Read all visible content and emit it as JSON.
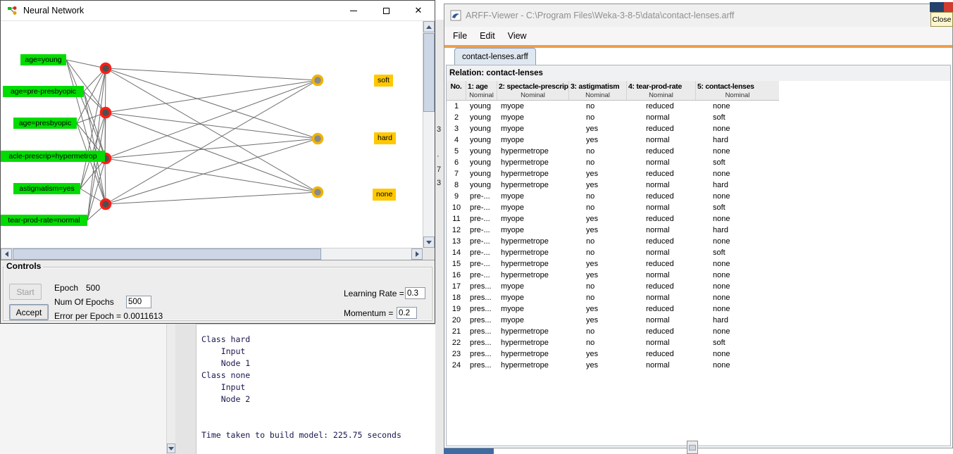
{
  "colors": {
    "input_label_bg": "#00dc00",
    "output_label_bg": "#ffc800",
    "hidden_node_ring": "#ff1e14",
    "hidden_node_center": "#4f4f4f",
    "output_node_ring": "#f0b400",
    "output_node_center": "#8a8a8a",
    "accent_line": "#ee9e49",
    "inactive_title_text": "#8f8f8f"
  },
  "icons": {
    "nn_window_icon": "mini-network",
    "arff_window_icon": "weka-document",
    "minimize": "horizontal-bar",
    "maximize": "square-outline",
    "close_glyph": "✕"
  },
  "nn_window": {
    "title": "Neural Network",
    "caption_buttons": {
      "close": "✕"
    },
    "network": {
      "input_labels": [
        "age=young",
        "age=pre-presbyopic",
        "age=presbyopic",
        "acle-prescrip=hypermetrop",
        "astigmatism=yes",
        "tear-prod-rate=normal"
      ],
      "output_labels": [
        "soft",
        "hard",
        "none"
      ]
    },
    "controls": {
      "group_title": "Controls",
      "start_button": "Start",
      "accept_button": "Accept",
      "epoch_label": "Epoch",
      "epoch_value": "500",
      "num_epochs_label": "Num Of Epochs",
      "num_epochs_value": "500",
      "error_line": "Error per Epoch = 0.0011613",
      "learning_rate_label": "Learning Rate =",
      "learning_rate_value": "0.3",
      "momentum_label": "Momentum =",
      "momentum_value": "0.2"
    }
  },
  "explorer_fragment": {
    "classifier_output_lines": [
      "Class hard",
      "    Input",
      "    Node 1",
      "Class none",
      "    Input",
      "    Node 2",
      "",
      "",
      "Time taken to build model: 225.75 seconds"
    ],
    "strip_fragments": [
      "3",
      "·",
      "7",
      "3"
    ]
  },
  "arff_viewer": {
    "title": "ARFF-Viewer - C:\\Program Files\\Weka-3-8-5\\data\\contact-lenses.arff",
    "menu_items": [
      "File",
      "Edit",
      "View"
    ],
    "tab_label": "contact-lenses.arff",
    "relation_label": "Relation: contact-lenses",
    "table": {
      "columns": [
        {
          "name": "No.",
          "type": ""
        },
        {
          "name": "1: age",
          "type": "Nominal"
        },
        {
          "name": "2: spectacle-prescrip",
          "type": "Nominal"
        },
        {
          "name": "3: astigmatism",
          "type": "Nominal"
        },
        {
          "name": "4: tear-prod-rate",
          "type": "Nominal"
        },
        {
          "name": "5: contact-lenses",
          "type": "Nominal"
        }
      ],
      "rows": [
        [
          "1",
          "young",
          "myope",
          "no",
          "reduced",
          "none"
        ],
        [
          "2",
          "young",
          "myope",
          "no",
          "normal",
          "soft"
        ],
        [
          "3",
          "young",
          "myope",
          "yes",
          "reduced",
          "none"
        ],
        [
          "4",
          "young",
          "myope",
          "yes",
          "normal",
          "hard"
        ],
        [
          "5",
          "young",
          "hypermetrope",
          "no",
          "reduced",
          "none"
        ],
        [
          "6",
          "young",
          "hypermetrope",
          "no",
          "normal",
          "soft"
        ],
        [
          "7",
          "young",
          "hypermetrope",
          "yes",
          "reduced",
          "none"
        ],
        [
          "8",
          "young",
          "hypermetrope",
          "yes",
          "normal",
          "hard"
        ],
        [
          "9",
          "pre-...",
          "myope",
          "no",
          "reduced",
          "none"
        ],
        [
          "10",
          "pre-...",
          "myope",
          "no",
          "normal",
          "soft"
        ],
        [
          "11",
          "pre-...",
          "myope",
          "yes",
          "reduced",
          "none"
        ],
        [
          "12",
          "pre-...",
          "myope",
          "yes",
          "normal",
          "hard"
        ],
        [
          "13",
          "pre-...",
          "hypermetrope",
          "no",
          "reduced",
          "none"
        ],
        [
          "14",
          "pre-...",
          "hypermetrope",
          "no",
          "normal",
          "soft"
        ],
        [
          "15",
          "pre-...",
          "hypermetrope",
          "yes",
          "reduced",
          "none"
        ],
        [
          "16",
          "pre-...",
          "hypermetrope",
          "yes",
          "normal",
          "none"
        ],
        [
          "17",
          "pres...",
          "myope",
          "no",
          "reduced",
          "none"
        ],
        [
          "18",
          "pres...",
          "myope",
          "no",
          "normal",
          "none"
        ],
        [
          "19",
          "pres...",
          "myope",
          "yes",
          "reduced",
          "none"
        ],
        [
          "20",
          "pres...",
          "myope",
          "yes",
          "normal",
          "hard"
        ],
        [
          "21",
          "pres...",
          "hypermetrope",
          "no",
          "reduced",
          "none"
        ],
        [
          "22",
          "pres...",
          "hypermetrope",
          "no",
          "normal",
          "soft"
        ],
        [
          "23",
          "pres...",
          "hypermetrope",
          "yes",
          "reduced",
          "none"
        ],
        [
          "24",
          "pres...",
          "hypermetrope",
          "yes",
          "normal",
          "none"
        ]
      ]
    }
  },
  "overlay_fragment": {
    "close_label": "Close"
  }
}
